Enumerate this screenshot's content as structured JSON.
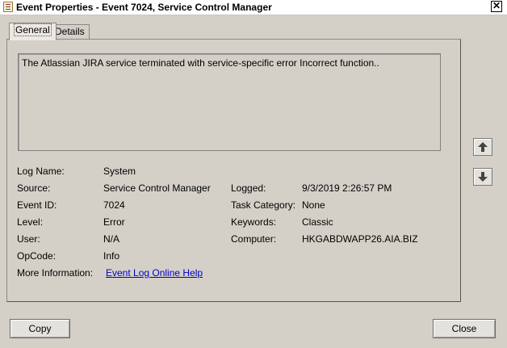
{
  "window": {
    "title": "Event Properties - Event 7024, Service Control Manager",
    "close_glyph": "✕",
    "icon": "event-viewer-icon"
  },
  "tabs": [
    {
      "label": "General",
      "selected": true
    },
    {
      "label": "Details",
      "selected": false
    }
  ],
  "message": "The Atlassian JIRA service terminated with service-specific error Incorrect function..",
  "fields": {
    "log_name": {
      "label": "Log Name:",
      "value": "System"
    },
    "source": {
      "label": "Source:",
      "value": "Service Control Manager"
    },
    "event_id": {
      "label": "Event ID:",
      "value": "7024"
    },
    "level": {
      "label": "Level:",
      "value": "Error"
    },
    "user": {
      "label": "User:",
      "value": "N/A"
    },
    "opcode": {
      "label": "OpCode:",
      "value": "Info"
    },
    "more_info": {
      "label": "More Information:",
      "value": "Event Log Online Help"
    },
    "logged": {
      "label": "Logged:",
      "value": "9/3/2019 2:26:57 PM"
    },
    "task_category": {
      "label": "Task Category:",
      "value": "None"
    },
    "keywords": {
      "label": "Keywords:",
      "value": "Classic"
    },
    "computer": {
      "label": "Computer:",
      "value": "HKGABDWAPP26.AIA.BIZ"
    }
  },
  "nav_buttons": {
    "up_icon": "arrow-up-icon",
    "down_icon": "arrow-down-icon"
  },
  "buttons": {
    "copy": "Copy",
    "close": "Close"
  }
}
